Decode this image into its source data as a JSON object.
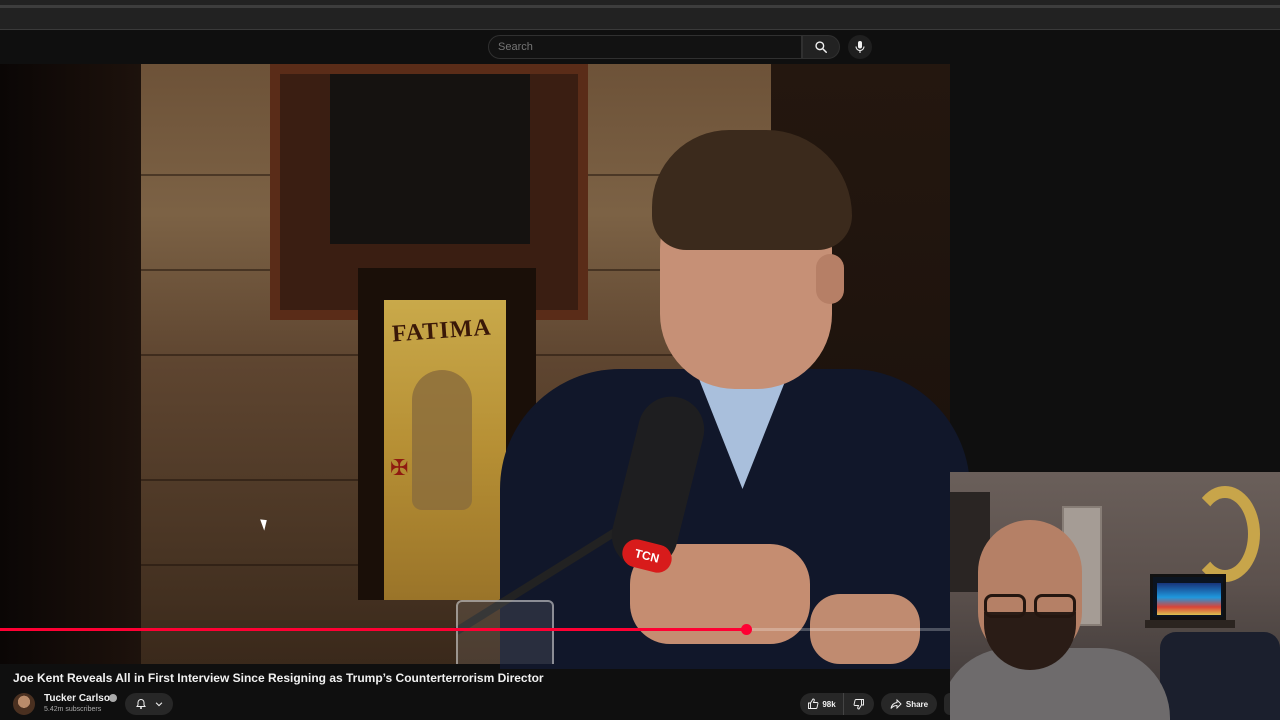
{
  "search": {
    "placeholder": "Search"
  },
  "video": {
    "title": "Joe Kent Reveals All in First Interview Since Resigning as Trump’s Counterterrorism Director",
    "progress_fraction": 0.785,
    "mic_brand": "TCN",
    "poster_text": "FATIMA"
  },
  "channel": {
    "name": "Tucker Carlson",
    "subscribers": "5.42m subscribers"
  },
  "actions": {
    "like_count": "98k",
    "share_label": "Share"
  },
  "colors": {
    "accent": "#ff0033",
    "background": "#0f0f0f",
    "button_bg": "#272727"
  },
  "icons": [
    "search-icon",
    "mic-icon",
    "bell-icon",
    "chevron-down-icon",
    "thumbs-up-icon",
    "thumbs-down-icon",
    "share-icon"
  ]
}
